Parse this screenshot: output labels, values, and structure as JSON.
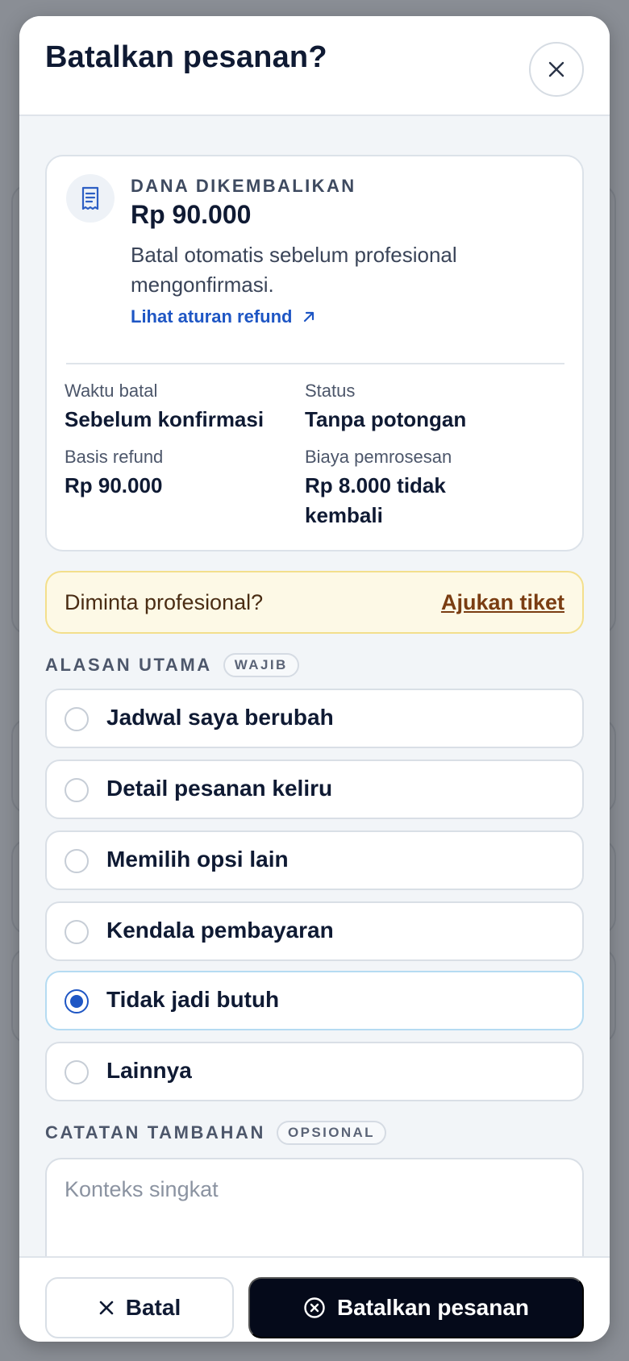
{
  "modal": {
    "title": "Batalkan pesanan?",
    "close_icon": "close-icon"
  },
  "refund": {
    "icon": "receipt-icon",
    "label": "DANA DIKEMBALIKAN",
    "amount": "Rp 90.000",
    "description": "Batal otomatis sebelum profesional mengonfirmasi.",
    "link_label": "Lihat aturan refund",
    "link_icon": "arrow-up-right-icon",
    "stats": [
      {
        "label": "Waktu batal",
        "value": "Sebelum konfirmasi"
      },
      {
        "label": "Status",
        "value": "Tanpa potongan"
      },
      {
        "label": "Basis refund",
        "value": "Rp 90.000"
      },
      {
        "label": "Biaya pemrosesan",
        "value": "Rp 8.000 tidak kembali"
      }
    ]
  },
  "ticket": {
    "text": "Diminta profesional?",
    "link_label": "Ajukan tiket"
  },
  "reason": {
    "label": "ALASAN UTAMA",
    "badge": "WAJIB",
    "options": [
      {
        "label": "Jadwal saya berubah",
        "selected": false
      },
      {
        "label": "Detail pesanan keliru",
        "selected": false
      },
      {
        "label": "Memilih opsi lain",
        "selected": false
      },
      {
        "label": "Kendala pembayaran",
        "selected": false
      },
      {
        "label": "Tidak jadi butuh",
        "selected": true
      },
      {
        "label": "Lainnya",
        "selected": false
      }
    ]
  },
  "note": {
    "label": "CATATAN TAMBAHAN",
    "badge": "OPSIONAL",
    "value": "",
    "placeholder": "Konteks singkat"
  },
  "footer": {
    "cancel_label": "Batal",
    "cancel_icon": "x-icon",
    "confirm_label": "Batalkan pesanan",
    "confirm_icon": "x-circle-icon"
  },
  "colors": {
    "accent": "#1e56c4",
    "primary_button": "#050a1a",
    "warning_bg": "#fdf9e6",
    "warning_text": "#7a3d12"
  }
}
